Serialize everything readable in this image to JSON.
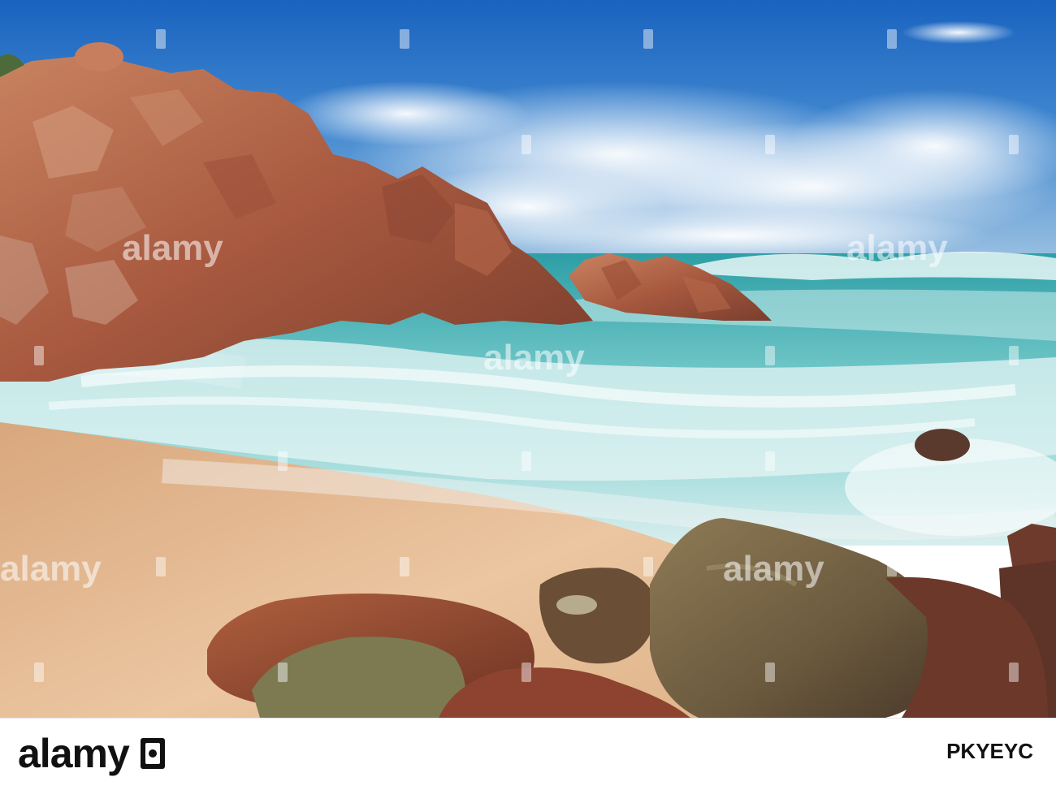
{
  "footer": {
    "brand": "alamy",
    "image_id": "PKYEYC"
  },
  "watermark": {
    "text": "alamy"
  },
  "colors": {
    "sky": "#1e6fc4",
    "sea": "#4fbcbc",
    "rock": "#b56a4c",
    "sand": "#e2b98f"
  }
}
